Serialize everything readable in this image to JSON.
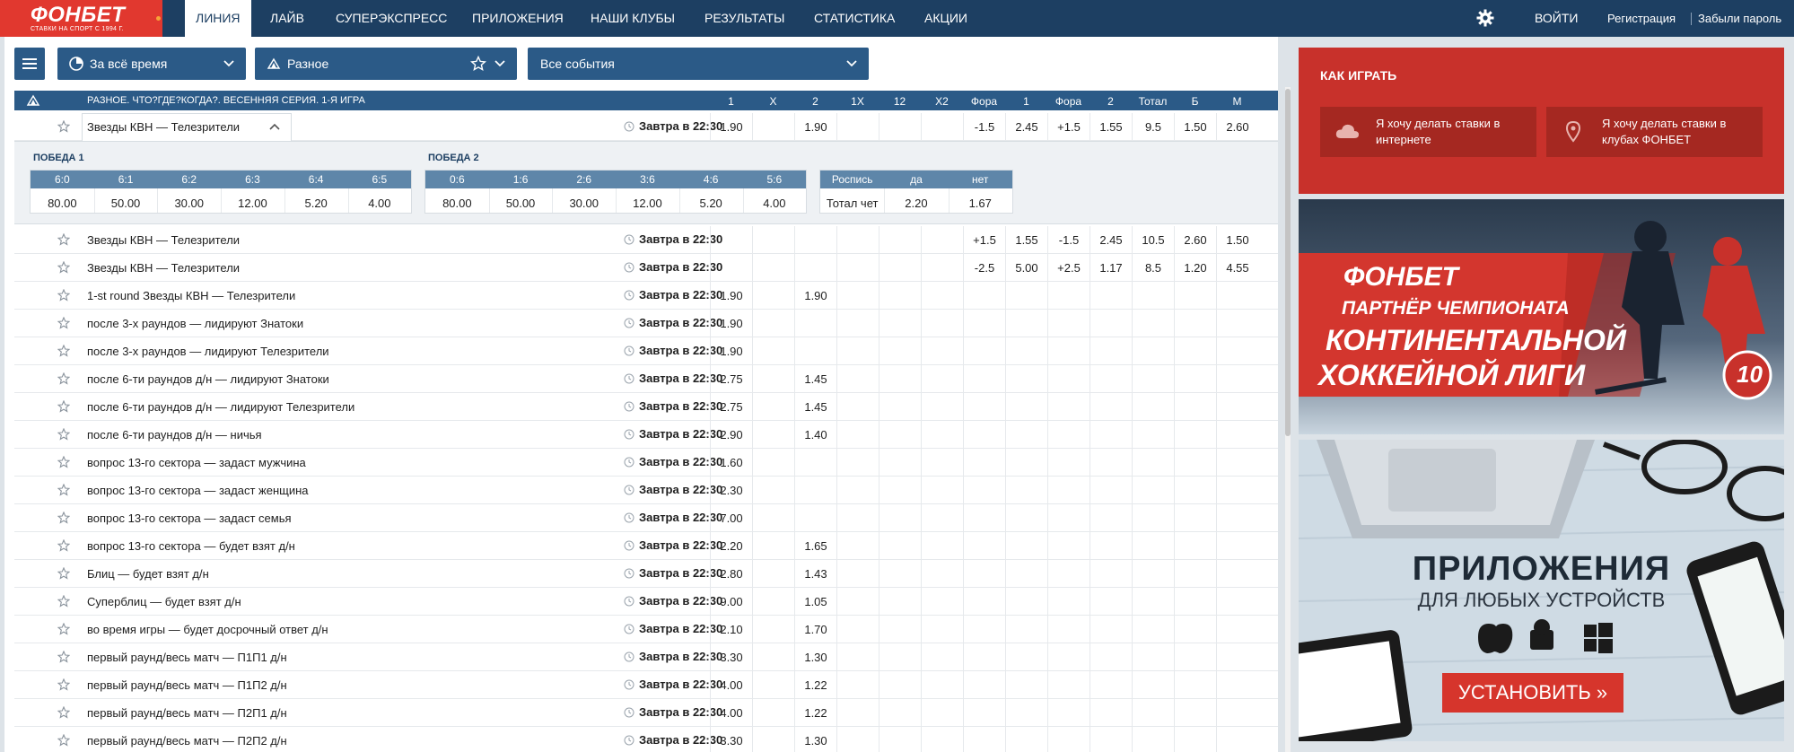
{
  "logo": {
    "brand": "ФОНБЕТ",
    "tagline": "СТАВКИ НА СПОРТ С 1994 Г."
  },
  "nav": {
    "tabs": [
      "ЛИНИЯ",
      "ЛАЙВ",
      "СУПЕРЭКСПРЕСС",
      "ПРИЛОЖЕНИЯ",
      "НАШИ КЛУБЫ",
      "РЕЗУЛЬТАТЫ",
      "СТАТИСТИКА",
      "АКЦИИ"
    ],
    "active_tab": "ЛИНИЯ",
    "login": "ВОЙТИ",
    "register": "Регистрация",
    "forgot": "Забыли пароль"
  },
  "filters": {
    "time": "За всё время",
    "sport": "Разное",
    "events": "Все события"
  },
  "table": {
    "title": "РАЗНОЕ. ЧТО?ГДЕ?КОГДА?. ВЕСЕННЯЯ СЕРИЯ. 1-Я ИГРА",
    "columns": [
      "1",
      "X",
      "2",
      "1X",
      "12",
      "X2",
      "Фора",
      "1",
      "Фора",
      "2",
      "Тотал",
      "Б",
      "М"
    ],
    "rows": [
      {
        "name": "Звезды КВН — Телезрители",
        "time": "Завтра в 22:30",
        "odds": [
          "1.90",
          "",
          "1.90",
          "",
          "",
          "",
          "-1.5",
          "2.45",
          "+1.5",
          "1.55",
          "9.5",
          "1.50",
          "2.60"
        ]
      },
      {
        "name": "Звезды КВН — Телезрители",
        "time": "Завтра в 22:30",
        "odds": [
          "",
          "",
          "",
          "",
          "",
          "",
          "+1.5",
          "1.55",
          "-1.5",
          "2.45",
          "10.5",
          "2.60",
          "1.50"
        ]
      },
      {
        "name": "Звезды КВН — Телезрители",
        "time": "Завтра в 22:30",
        "odds": [
          "",
          "",
          "",
          "",
          "",
          "",
          "-2.5",
          "5.00",
          "+2.5",
          "1.17",
          "8.5",
          "1.20",
          "4.55"
        ]
      },
      {
        "name": "1-st round Звезды КВН — Телезрители",
        "time": "Завтра в 22:30",
        "odds": [
          "1.90",
          "",
          "1.90",
          "",
          "",
          "",
          "",
          "",
          "",
          "",
          "",
          "",
          ""
        ]
      },
      {
        "name": "после 3-х раундов — лидируют Знатоки",
        "time": "Завтра в 22:30",
        "odds": [
          "1.90",
          "",
          "",
          "",
          "",
          "",
          "",
          "",
          "",
          "",
          "",
          "",
          ""
        ]
      },
      {
        "name": "после 3-х раундов — лидируют Телезрители",
        "time": "Завтра в 22:30",
        "odds": [
          "1.90",
          "",
          "",
          "",
          "",
          "",
          "",
          "",
          "",
          "",
          "",
          "",
          ""
        ]
      },
      {
        "name": "после 6-ти раундов д/н — лидируют Знатоки",
        "time": "Завтра в 22:30",
        "odds": [
          "2.75",
          "",
          "1.45",
          "",
          "",
          "",
          "",
          "",
          "",
          "",
          "",
          "",
          ""
        ]
      },
      {
        "name": "после 6-ти раундов д/н — лидируют Телезрители",
        "time": "Завтра в 22:30",
        "odds": [
          "2.75",
          "",
          "1.45",
          "",
          "",
          "",
          "",
          "",
          "",
          "",
          "",
          "",
          ""
        ]
      },
      {
        "name": "после 6-ти раундов д/н — ничья",
        "time": "Завтра в 22:30",
        "odds": [
          "2.90",
          "",
          "1.40",
          "",
          "",
          "",
          "",
          "",
          "",
          "",
          "",
          "",
          ""
        ]
      },
      {
        "name": "вопрос 13-го сектора — задаст мужчина",
        "time": "Завтра в 22:30",
        "odds": [
          "1.60",
          "",
          "",
          "",
          "",
          "",
          "",
          "",
          "",
          "",
          "",
          "",
          ""
        ]
      },
      {
        "name": "вопрос 13-го сектора — задаст женщина",
        "time": "Завтра в 22:30",
        "odds": [
          "2.30",
          "",
          "",
          "",
          "",
          "",
          "",
          "",
          "",
          "",
          "",
          "",
          ""
        ]
      },
      {
        "name": "вопрос 13-го сектора — задаст семья",
        "time": "Завтра в 22:30",
        "odds": [
          "7.00",
          "",
          "",
          "",
          "",
          "",
          "",
          "",
          "",
          "",
          "",
          "",
          ""
        ]
      },
      {
        "name": "вопрос 13-го сектора — будет взят д/н",
        "time": "Завтра в 22:30",
        "odds": [
          "2.20",
          "",
          "1.65",
          "",
          "",
          "",
          "",
          "",
          "",
          "",
          "",
          "",
          ""
        ]
      },
      {
        "name": "Блиц — будет взят д/н",
        "time": "Завтра в 22:30",
        "odds": [
          "2.80",
          "",
          "1.43",
          "",
          "",
          "",
          "",
          "",
          "",
          "",
          "",
          "",
          ""
        ]
      },
      {
        "name": "Суперблиц — будет взят д/н",
        "time": "Завтра в 22:30",
        "odds": [
          "9.00",
          "",
          "1.05",
          "",
          "",
          "",
          "",
          "",
          "",
          "",
          "",
          "",
          ""
        ]
      },
      {
        "name": "во время игры — будет досрочный ответ д/н",
        "time": "Завтра в 22:30",
        "odds": [
          "2.10",
          "",
          "1.70",
          "",
          "",
          "",
          "",
          "",
          "",
          "",
          "",
          "",
          ""
        ]
      },
      {
        "name": "первый раунд/весь матч — П1П1 д/н",
        "time": "Завтра в 22:30",
        "odds": [
          "3.30",
          "",
          "1.30",
          "",
          "",
          "",
          "",
          "",
          "",
          "",
          "",
          "",
          ""
        ]
      },
      {
        "name": "первый раунд/весь матч — П1П2 д/н",
        "time": "Завтра в 22:30",
        "odds": [
          "4.00",
          "",
          "1.22",
          "",
          "",
          "",
          "",
          "",
          "",
          "",
          "",
          "",
          ""
        ]
      },
      {
        "name": "первый раунд/весь матч — П2П1 д/н",
        "time": "Завтра в 22:30",
        "odds": [
          "4.00",
          "",
          "1.22",
          "",
          "",
          "",
          "",
          "",
          "",
          "",
          "",
          "",
          ""
        ]
      },
      {
        "name": "первый раунд/весь матч — П2П2 д/н",
        "time": "Завтра в 22:30",
        "odds": [
          "3.30",
          "",
          "1.30",
          "",
          "",
          "",
          "",
          "",
          "",
          "",
          "",
          "",
          ""
        ]
      }
    ]
  },
  "expanded": {
    "win1": {
      "title": "ПОБЕДА 1",
      "headers": [
        "6:0",
        "6:1",
        "6:2",
        "6:3",
        "6:4",
        "6:5"
      ],
      "values": [
        "80.00",
        "50.00",
        "30.00",
        "12.00",
        "5.20",
        "4.00"
      ]
    },
    "win2": {
      "title": "ПОБЕДА 2",
      "headers": [
        "0:6",
        "1:6",
        "2:6",
        "3:6",
        "4:6",
        "5:6"
      ],
      "values": [
        "80.00",
        "50.00",
        "30.00",
        "12.00",
        "5.20",
        "4.00"
      ]
    },
    "extra": {
      "headers": [
        "Роспись",
        "да",
        "нет"
      ],
      "values": [
        "Тотал чет",
        "2.20",
        "1.67"
      ]
    }
  },
  "howto": {
    "title": "КАК ИГРАТЬ",
    "online": "Я хочу делать ставки в интернете",
    "clubs": "Я хочу делать ставки в клубах ФОНБЕТ"
  },
  "banner_khl": {
    "lines": [
      "ФОНБЕТ",
      "ПАРТНЁР ЧЕМПИОНАТА",
      "КОНТИНЕНТАЛЬНОЙ",
      "ХОККЕЙНОЙ ЛИГИ"
    ],
    "badge": "10"
  },
  "banner_apps": {
    "title": "ПРИЛОЖЕНИЯ",
    "subtitle": "ДЛЯ ЛЮБЫХ УСТРОЙСТВ",
    "install": "УСТАНОВИТЬ »"
  },
  "colors": {
    "navy": "#1d3f62",
    "header_blue": "#2b5a87",
    "brand_red": "#e1382f",
    "panel_red": "#c8312b"
  }
}
